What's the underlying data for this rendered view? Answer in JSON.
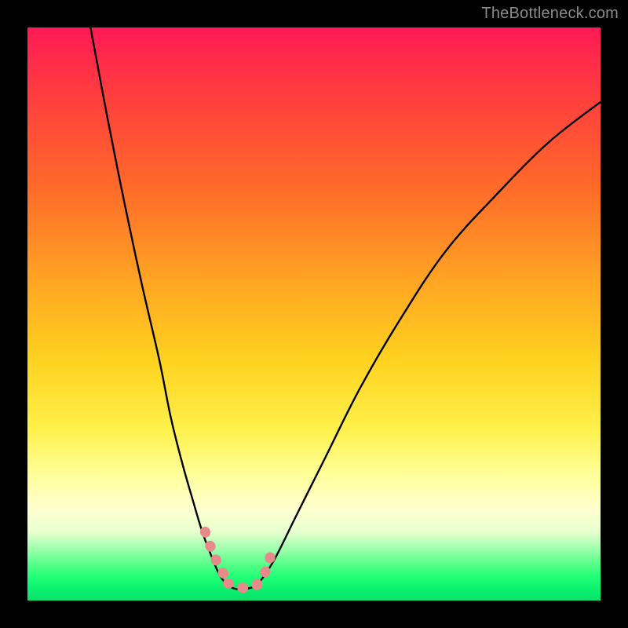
{
  "watermark": "TheBottleneck.com",
  "chart_data": {
    "type": "line",
    "title": "",
    "xlabel": "",
    "ylabel": "",
    "xlim": [
      0,
      100
    ],
    "ylim": [
      0,
      100
    ],
    "series": [
      {
        "name": "left-curve",
        "x": [
          11,
          14,
          17,
          20,
          23,
          25,
          27,
          29,
          30.5,
          32,
          33.5,
          35
        ],
        "values": [
          100,
          84,
          69,
          55,
          42,
          32,
          24,
          17,
          12,
          8,
          4.5,
          2.5
        ]
      },
      {
        "name": "right-curve",
        "x": [
          40,
          43,
          47,
          52,
          58,
          65,
          73,
          82,
          91,
          100
        ],
        "values": [
          2.5,
          7,
          15,
          25,
          37,
          49,
          61,
          71,
          80,
          87
        ]
      },
      {
        "name": "bottom-flat",
        "x": [
          35,
          36.5,
          38,
          40
        ],
        "values": [
          2.5,
          2,
          2,
          2.5
        ]
      },
      {
        "name": "highlight-left-segment",
        "x": [
          31,
          32.5,
          34,
          35.5
        ],
        "values": [
          12,
          8,
          5,
          3.5
        ]
      },
      {
        "name": "highlight-right-segment",
        "x": [
          40,
          41.5,
          42.5
        ],
        "values": [
          2.8,
          5,
          8
        ]
      },
      {
        "name": "highlight-bottom-segment",
        "x": [
          35,
          37,
          39,
          40.5
        ],
        "values": [
          3,
          2.3,
          2.3,
          3
        ]
      }
    ],
    "colors": {
      "curve": "#000000",
      "highlight": "#e68a8a"
    }
  }
}
